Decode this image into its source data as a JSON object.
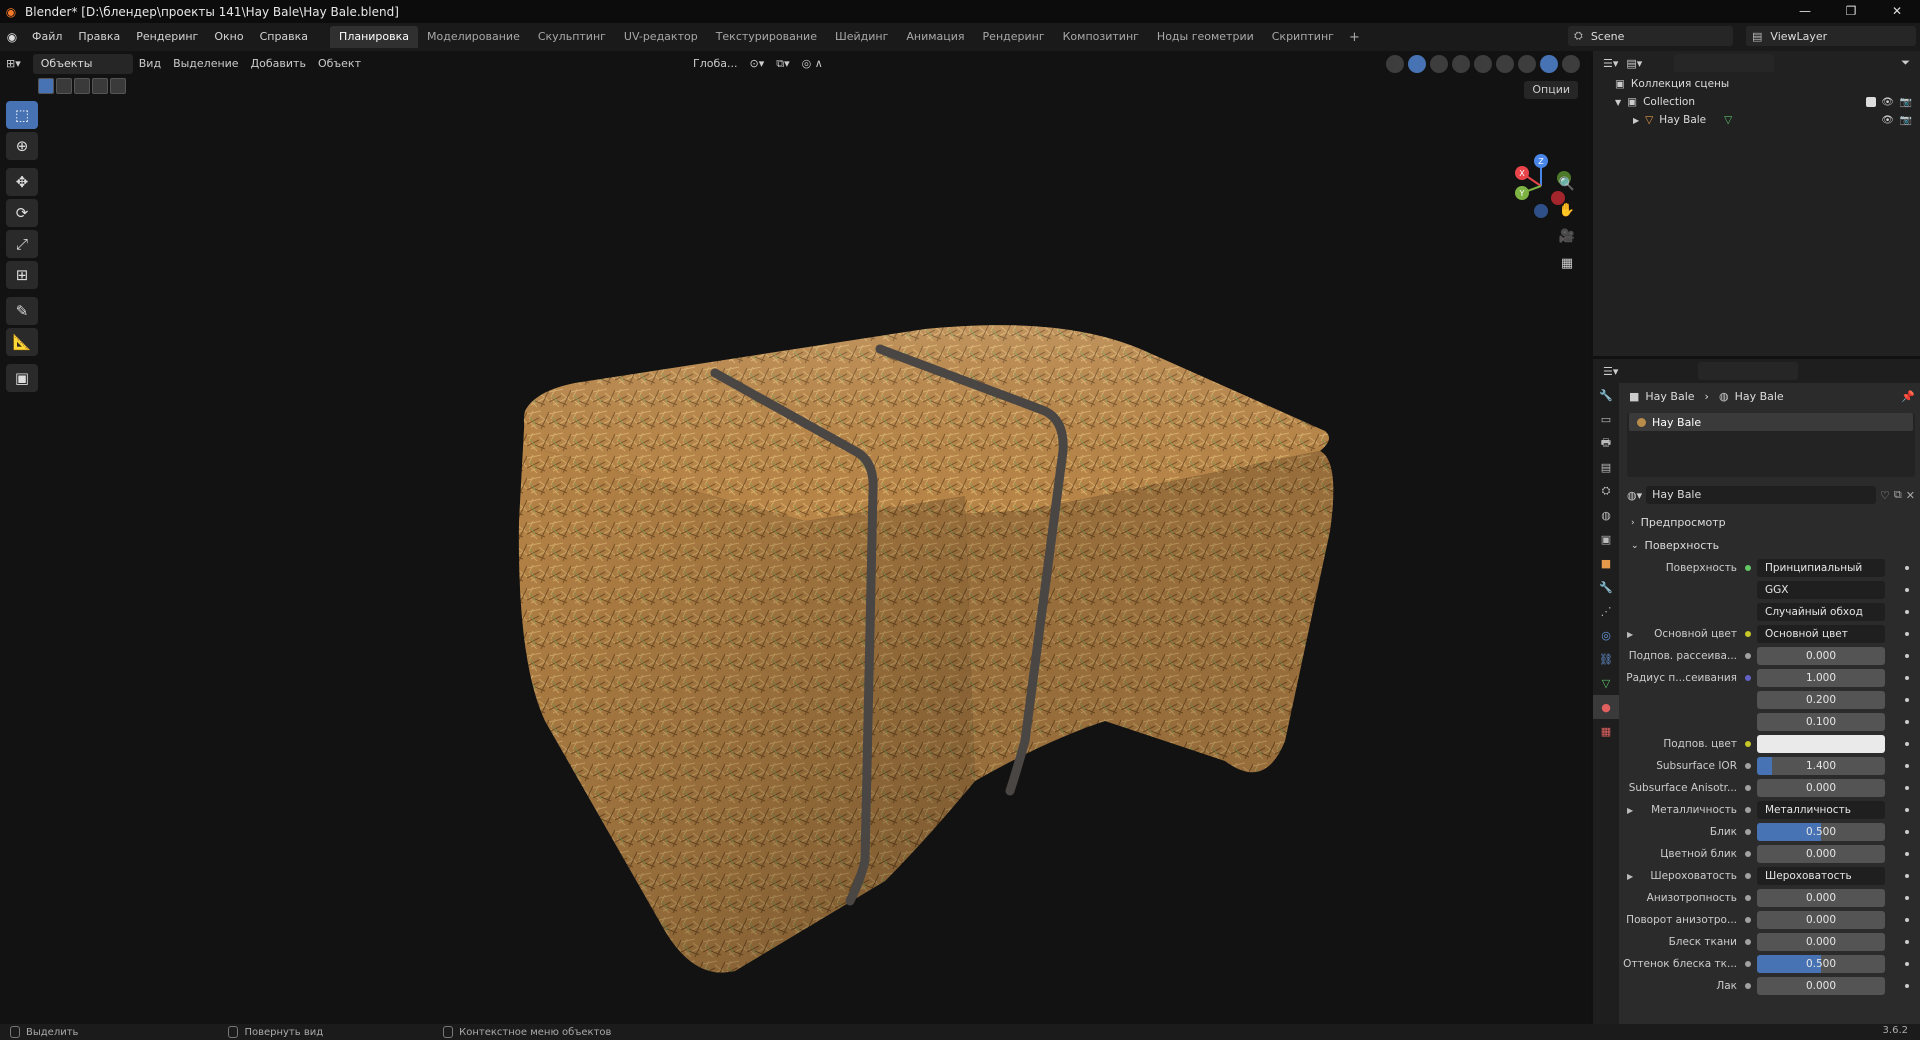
{
  "window": {
    "title": "Blender* [D:\\блендер\\проекты 141\\Hay Bale\\Hay Bale.blend]"
  },
  "menu": {
    "items": [
      "Файл",
      "Правка",
      "Рендеринг",
      "Окно",
      "Справка"
    ]
  },
  "workspaces": {
    "tabs": [
      "Планировка",
      "Моделирование",
      "Скульптинг",
      "UV-редактор",
      "Текстурирование",
      "Шейдинг",
      "Анимация",
      "Рендеринг",
      "Композитинг",
      "Ноды геометрии",
      "Скриптинг"
    ],
    "add": "+"
  },
  "scene": {
    "name": "Scene",
    "view_layer": "ViewLayer"
  },
  "viewport": {
    "mode": "Объекты",
    "menus": [
      "Вид",
      "Выделение",
      "Добавить",
      "Объект"
    ],
    "orientation": "Глоба...",
    "options": "Опции",
    "gizmo": {
      "x": "X",
      "y": "Y",
      "z": "Z"
    }
  },
  "outliner": {
    "root": "Коллекция сцены",
    "collection": "Collection",
    "object": "Hay Bale"
  },
  "properties": {
    "breadcrumb": [
      "Hay Bale",
      "Hay Bale"
    ],
    "slot": "Hay Bale",
    "material": "Hay Bale",
    "panels": {
      "preview": "Предпросмотр",
      "surface": "Поверхность"
    },
    "rows": [
      {
        "label": "Поверхность",
        "value": "Принципиальный BSDF",
        "kind": "dark",
        "sock": "g"
      },
      {
        "label": "",
        "value": "GGX",
        "kind": "dark"
      },
      {
        "label": "",
        "value": "Случайный обход",
        "kind": "dark"
      },
      {
        "label": "Основной цвет",
        "value": "Основной цвет",
        "kind": "dark",
        "sock": "y",
        "tri": true
      },
      {
        "label": "Подпов. рассеива...",
        "value": "0.000",
        "kind": "num",
        "sock": "gr"
      },
      {
        "label": "Радиус п...сеивания",
        "value": "1.000",
        "kind": "num",
        "sock": "b"
      },
      {
        "label": "",
        "value": "0.200",
        "kind": "num"
      },
      {
        "label": "",
        "value": "0.100",
        "kind": "num"
      },
      {
        "label": "Подпов. цвет",
        "value": "",
        "kind": "white",
        "sock": "y"
      },
      {
        "label": "Subsurface IOR",
        "value": "1.400",
        "kind": "num",
        "sock": "gr",
        "fill": 0.12
      },
      {
        "label": "Subsurface Anisotr...",
        "value": "0.000",
        "kind": "num",
        "sock": "gr"
      },
      {
        "label": "Металличность",
        "value": "Металличность",
        "kind": "dark",
        "sock": "gr",
        "tri": true
      },
      {
        "label": "Блик",
        "value": "0.500",
        "kind": "num",
        "sock": "gr",
        "fill": 0.5
      },
      {
        "label": "Цветной блик",
        "value": "0.000",
        "kind": "num",
        "sock": "gr"
      },
      {
        "label": "Шероховатость",
        "value": "Шероховатость",
        "kind": "dark",
        "sock": "gr",
        "tri": true
      },
      {
        "label": "Анизотропность",
        "value": "0.000",
        "kind": "num",
        "sock": "gr"
      },
      {
        "label": "Поворот анизотро...",
        "value": "0.000",
        "kind": "num",
        "sock": "gr"
      },
      {
        "label": "Блеск ткани",
        "value": "0.000",
        "kind": "num",
        "sock": "gr"
      },
      {
        "label": "Оттенок блеска тк...",
        "value": "0.500",
        "kind": "num",
        "sock": "gr",
        "fill": 0.5
      },
      {
        "label": "Лак",
        "value": "0.000",
        "kind": "num",
        "sock": "gr"
      }
    ]
  },
  "status": {
    "select": "Выделить",
    "rotate": "Повернуть вид",
    "context": "Контекстное меню объектов",
    "version": "3.6.2"
  },
  "colors": {
    "accent": "#4772b3",
    "hay": "#b98648",
    "strap": "#4a4644",
    "bg": "#121212"
  }
}
